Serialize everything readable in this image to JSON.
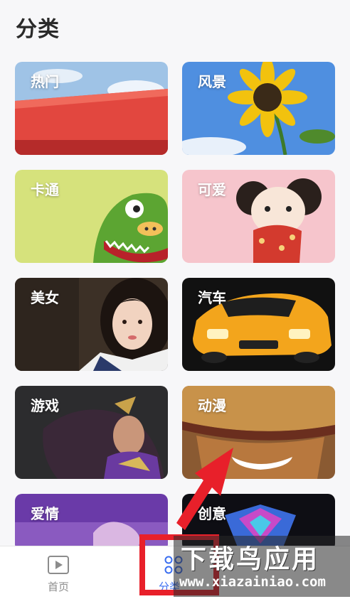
{
  "page": {
    "title": "分类"
  },
  "categories": [
    {
      "label": "热门"
    },
    {
      "label": "风景"
    },
    {
      "label": "卡通"
    },
    {
      "label": "可爱"
    },
    {
      "label": "美女"
    },
    {
      "label": "汽车"
    },
    {
      "label": "游戏"
    },
    {
      "label": "动漫"
    },
    {
      "label": "爱情"
    },
    {
      "label": "创意"
    }
  ],
  "tabbar": {
    "home_label": "首页",
    "category_label": "分类",
    "active_color": "#3b6ef0",
    "inactive_color": "#8c8c8c"
  },
  "watermark": {
    "text_cn": "下载鸟应用",
    "text_url": "www.xiazainiao.com"
  },
  "highlight": {
    "color": "#e8202a"
  }
}
